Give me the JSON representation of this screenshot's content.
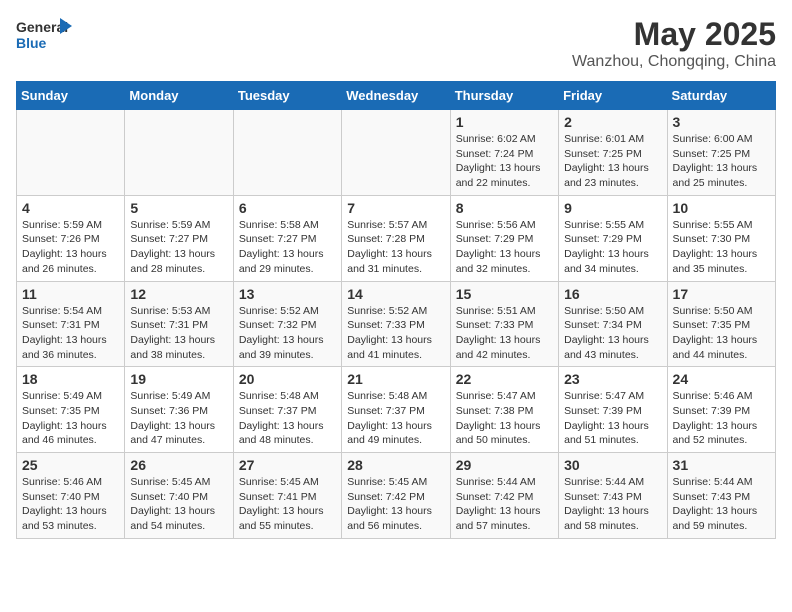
{
  "header": {
    "logo_line1": "General",
    "logo_line2": "Blue",
    "month": "May 2025",
    "location": "Wanzhou, Chongqing, China"
  },
  "weekdays": [
    "Sunday",
    "Monday",
    "Tuesday",
    "Wednesday",
    "Thursday",
    "Friday",
    "Saturday"
  ],
  "weeks": [
    [
      {
        "day": "",
        "info": ""
      },
      {
        "day": "",
        "info": ""
      },
      {
        "day": "",
        "info": ""
      },
      {
        "day": "",
        "info": ""
      },
      {
        "day": "1",
        "info": "Sunrise: 6:02 AM\nSunset: 7:24 PM\nDaylight: 13 hours\nand 22 minutes."
      },
      {
        "day": "2",
        "info": "Sunrise: 6:01 AM\nSunset: 7:25 PM\nDaylight: 13 hours\nand 23 minutes."
      },
      {
        "day": "3",
        "info": "Sunrise: 6:00 AM\nSunset: 7:25 PM\nDaylight: 13 hours\nand 25 minutes."
      }
    ],
    [
      {
        "day": "4",
        "info": "Sunrise: 5:59 AM\nSunset: 7:26 PM\nDaylight: 13 hours\nand 26 minutes."
      },
      {
        "day": "5",
        "info": "Sunrise: 5:59 AM\nSunset: 7:27 PM\nDaylight: 13 hours\nand 28 minutes."
      },
      {
        "day": "6",
        "info": "Sunrise: 5:58 AM\nSunset: 7:27 PM\nDaylight: 13 hours\nand 29 minutes."
      },
      {
        "day": "7",
        "info": "Sunrise: 5:57 AM\nSunset: 7:28 PM\nDaylight: 13 hours\nand 31 minutes."
      },
      {
        "day": "8",
        "info": "Sunrise: 5:56 AM\nSunset: 7:29 PM\nDaylight: 13 hours\nand 32 minutes."
      },
      {
        "day": "9",
        "info": "Sunrise: 5:55 AM\nSunset: 7:29 PM\nDaylight: 13 hours\nand 34 minutes."
      },
      {
        "day": "10",
        "info": "Sunrise: 5:55 AM\nSunset: 7:30 PM\nDaylight: 13 hours\nand 35 minutes."
      }
    ],
    [
      {
        "day": "11",
        "info": "Sunrise: 5:54 AM\nSunset: 7:31 PM\nDaylight: 13 hours\nand 36 minutes."
      },
      {
        "day": "12",
        "info": "Sunrise: 5:53 AM\nSunset: 7:31 PM\nDaylight: 13 hours\nand 38 minutes."
      },
      {
        "day": "13",
        "info": "Sunrise: 5:52 AM\nSunset: 7:32 PM\nDaylight: 13 hours\nand 39 minutes."
      },
      {
        "day": "14",
        "info": "Sunrise: 5:52 AM\nSunset: 7:33 PM\nDaylight: 13 hours\nand 41 minutes."
      },
      {
        "day": "15",
        "info": "Sunrise: 5:51 AM\nSunset: 7:33 PM\nDaylight: 13 hours\nand 42 minutes."
      },
      {
        "day": "16",
        "info": "Sunrise: 5:50 AM\nSunset: 7:34 PM\nDaylight: 13 hours\nand 43 minutes."
      },
      {
        "day": "17",
        "info": "Sunrise: 5:50 AM\nSunset: 7:35 PM\nDaylight: 13 hours\nand 44 minutes."
      }
    ],
    [
      {
        "day": "18",
        "info": "Sunrise: 5:49 AM\nSunset: 7:35 PM\nDaylight: 13 hours\nand 46 minutes."
      },
      {
        "day": "19",
        "info": "Sunrise: 5:49 AM\nSunset: 7:36 PM\nDaylight: 13 hours\nand 47 minutes."
      },
      {
        "day": "20",
        "info": "Sunrise: 5:48 AM\nSunset: 7:37 PM\nDaylight: 13 hours\nand 48 minutes."
      },
      {
        "day": "21",
        "info": "Sunrise: 5:48 AM\nSunset: 7:37 PM\nDaylight: 13 hours\nand 49 minutes."
      },
      {
        "day": "22",
        "info": "Sunrise: 5:47 AM\nSunset: 7:38 PM\nDaylight: 13 hours\nand 50 minutes."
      },
      {
        "day": "23",
        "info": "Sunrise: 5:47 AM\nSunset: 7:39 PM\nDaylight: 13 hours\nand 51 minutes."
      },
      {
        "day": "24",
        "info": "Sunrise: 5:46 AM\nSunset: 7:39 PM\nDaylight: 13 hours\nand 52 minutes."
      }
    ],
    [
      {
        "day": "25",
        "info": "Sunrise: 5:46 AM\nSunset: 7:40 PM\nDaylight: 13 hours\nand 53 minutes."
      },
      {
        "day": "26",
        "info": "Sunrise: 5:45 AM\nSunset: 7:40 PM\nDaylight: 13 hours\nand 54 minutes."
      },
      {
        "day": "27",
        "info": "Sunrise: 5:45 AM\nSunset: 7:41 PM\nDaylight: 13 hours\nand 55 minutes."
      },
      {
        "day": "28",
        "info": "Sunrise: 5:45 AM\nSunset: 7:42 PM\nDaylight: 13 hours\nand 56 minutes."
      },
      {
        "day": "29",
        "info": "Sunrise: 5:44 AM\nSunset: 7:42 PM\nDaylight: 13 hours\nand 57 minutes."
      },
      {
        "day": "30",
        "info": "Sunrise: 5:44 AM\nSunset: 7:43 PM\nDaylight: 13 hours\nand 58 minutes."
      },
      {
        "day": "31",
        "info": "Sunrise: 5:44 AM\nSunset: 7:43 PM\nDaylight: 13 hours\nand 59 minutes."
      }
    ]
  ]
}
